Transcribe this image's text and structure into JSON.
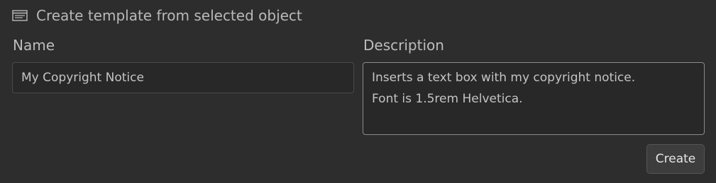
{
  "dialog": {
    "title": "Create template from selected object",
    "icon": "template-icon"
  },
  "name_field": {
    "label": "Name",
    "value": "My Copyright Notice"
  },
  "description_field": {
    "label": "Description",
    "value": "Inserts a text box with my copyright notice.\nFont is 1.5rem Helvetica."
  },
  "actions": {
    "create_label": "Create"
  },
  "colors": {
    "background": "#2d2d2d",
    "input_background": "#282828",
    "focused_border": "#8a8a8a",
    "button_background": "#3d3d3d"
  }
}
